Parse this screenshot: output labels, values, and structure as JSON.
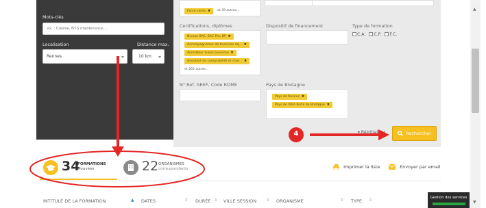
{
  "keywords": {
    "label": "Mots-clés",
    "placeholder": "ex. : Cuisine, BTS maintenance, ..."
  },
  "location": {
    "label": "Localisation",
    "value": "Rennes"
  },
  "distance": {
    "label": "Distance max.",
    "value": "10 km"
  },
  "top_tags": {
    "tag": "Force vente",
    "more": "et 39 autres..."
  },
  "certifications": {
    "label": "Certifications, diplômes",
    "tags": [
      "Niveau BAC, BAC Pro, BP",
      "Accompagnateur de tourisme éq...",
      "Animateur loisirs tourisme",
      "Assistant de comptabilité et d'ad..."
    ],
    "more": "et 263 autres..."
  },
  "funding": {
    "label": "Dispositif de financement"
  },
  "training_type": {
    "label": "Type de formation",
    "options": [
      "C.A.",
      "C.P.",
      "F.C."
    ]
  },
  "ref_gref": {
    "label": "N° Ref. GREF, Code ROME"
  },
  "pays": {
    "label": "Pays de Bretagne",
    "tags": [
      "Pays de Rennes",
      "Pays de Vitré Porte de Bretagne"
    ]
  },
  "reinit": {
    "label": "Réinitialiser"
  },
  "search_button": {
    "label": "Rechercher"
  },
  "annotation": {
    "number": "4"
  },
  "results": {
    "formations": {
      "count": "34",
      "line1": "FORMATIONS",
      "line2": "trouvées"
    },
    "organismes": {
      "count": "22",
      "line1": "ORGANISMES",
      "line2": "correspondants"
    }
  },
  "print": {
    "label": "Imprimer la liste"
  },
  "email": {
    "label": "Envoyer par email"
  },
  "table_headers": [
    {
      "label": "INTITULÉ DE LA FORMATION"
    },
    {
      "label": "DATES"
    },
    {
      "label": "DURÉE"
    },
    {
      "label": "VILLE SESSION"
    },
    {
      "label": "ORGANISME"
    },
    {
      "label": "TYPE"
    }
  ],
  "gestion": {
    "label": "Gestion des services"
  },
  "colors": {
    "accent": "#f5c020",
    "annotation": "#e32626",
    "dark_panel": "#3a3a3a"
  }
}
